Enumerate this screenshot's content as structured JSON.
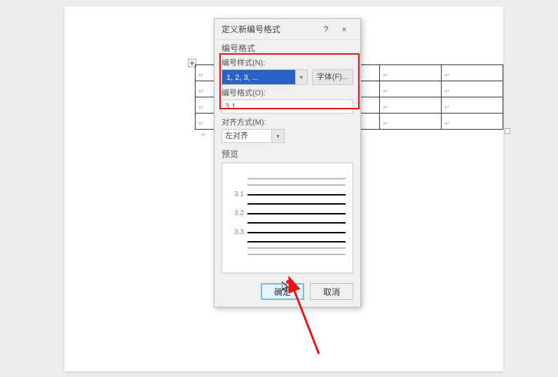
{
  "dialog": {
    "title": "定义新编号格式",
    "help_icon": "?",
    "close_icon": "×",
    "section_format": "编号格式",
    "style_label": "编号样式(N):",
    "style_value": "1, 2, 3, ...",
    "font_button": "字体(F)...",
    "format_label": "编号格式(O):",
    "format_value": "3.1",
    "align_label": "对齐方式(M):",
    "align_value": "左对齐",
    "preview_label": "预览",
    "preview_items": [
      "3.1",
      "3.2",
      "3.3"
    ],
    "ok": "确定",
    "cancel": "取消"
  },
  "table_marker": "↵",
  "cross": "✥",
  "chevron": "▾"
}
